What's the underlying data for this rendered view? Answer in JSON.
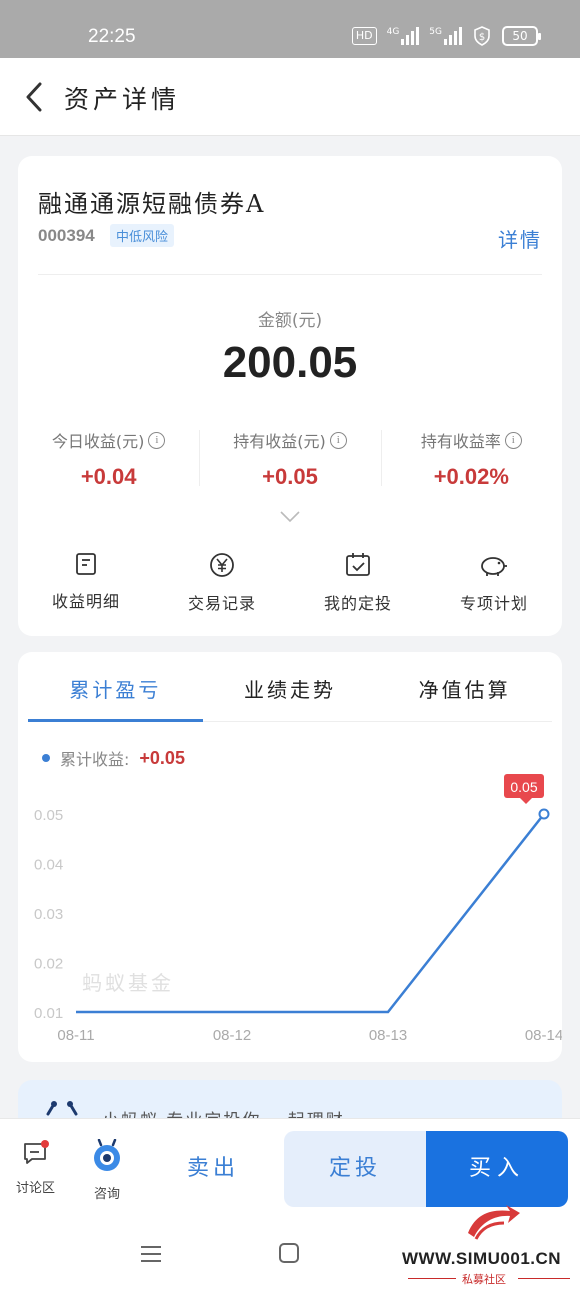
{
  "status_bar": {
    "time": "22:25",
    "hd_label": "HD",
    "net1": "4G",
    "net2": "5G",
    "battery": "50"
  },
  "nav": {
    "title": "资产详情",
    "back_icon": "chevron-left-icon"
  },
  "fund": {
    "name": "融通通源短融债券A",
    "code": "000394",
    "risk_badge": "中低风险",
    "detail_link": "详情"
  },
  "amount": {
    "label": "金额(元)",
    "value": "200.05"
  },
  "stats": [
    {
      "label": "今日收益(元)",
      "value": "+0.04"
    },
    {
      "label": "持有收益(元)",
      "value": "+0.05"
    },
    {
      "label": "持有收益率",
      "value": "+0.02%"
    }
  ],
  "info_glyph": "i",
  "actions": [
    {
      "label": "收益明细",
      "icon": "document-icon"
    },
    {
      "label": "交易记录",
      "icon": "yen-circle-icon"
    },
    {
      "label": "我的定投",
      "icon": "calendar-check-icon"
    },
    {
      "label": "专项计划",
      "icon": "piggy-bank-icon"
    }
  ],
  "tabs": [
    {
      "label": "累计盈亏",
      "active": true
    },
    {
      "label": "业绩走势",
      "active": false
    },
    {
      "label": "净值估算",
      "active": false
    }
  ],
  "legend": {
    "label": "累计收益:",
    "value": "+0.05"
  },
  "watermark": "蚂蚁基金",
  "chart_data": {
    "type": "line",
    "x": [
      "08-11",
      "08-12",
      "08-13",
      "08-14"
    ],
    "series": [
      {
        "values": [
          0.01,
          0.01,
          0.01,
          0.05
        ]
      }
    ],
    "y_ticks": [
      "0.05",
      "0.04",
      "0.03",
      "0.02",
      "0.01"
    ],
    "ylim": [
      0.01,
      0.05
    ],
    "last_point_label": "0.05",
    "line_color": "#3b7fd4",
    "tooltip_color": "#e8484d"
  },
  "promo_text": "小蚂蚁 专业定投你 一起理财",
  "bottom_bar": {
    "discuss": "讨论区",
    "consult": "咨询",
    "sell": "卖出",
    "dingtou": "定投",
    "buy": "买入"
  },
  "site_watermark": {
    "url": "WWW.SIMU001.CN",
    "sub": "私募社区"
  },
  "colors": {
    "accent": "#3b7fd4",
    "positive": "#c83a3a",
    "buy_button": "#1a72e0"
  }
}
